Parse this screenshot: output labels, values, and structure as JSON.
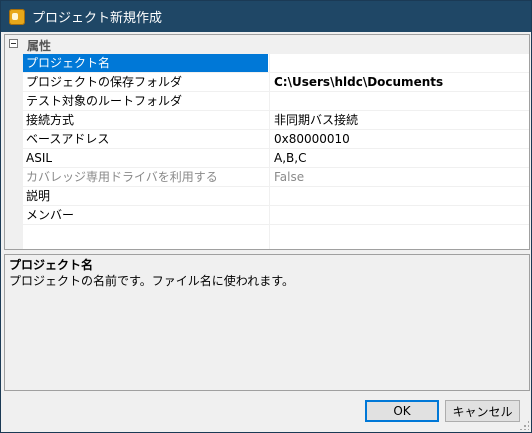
{
  "window": {
    "title": "プロジェクト新規作成"
  },
  "grid": {
    "category": "属性",
    "rows": [
      {
        "name": "プロジェクト名",
        "value": "",
        "selected": true
      },
      {
        "name": "プロジェクトの保存フォルダ",
        "value": "C:\\Users\\hldc\\Documents",
        "bold": true
      },
      {
        "name": "テスト対象のルートフォルダ",
        "value": ""
      },
      {
        "name": "接続方式",
        "value": "非同期バス接続"
      },
      {
        "name": "ベースアドレス",
        "value": "0x80000010"
      },
      {
        "name": "ASIL",
        "value": "A,B,C"
      },
      {
        "name": "カバレッジ専用ドライバを利用する",
        "value": "False",
        "disabled": true
      },
      {
        "name": "説明",
        "value": ""
      },
      {
        "name": "メンバー",
        "value": ""
      }
    ]
  },
  "description": {
    "title": "プロジェクト名",
    "text": "プロジェクトの名前です。ファイル名に使われます。"
  },
  "buttons": {
    "ok": "OK",
    "cancel": "キャンセル"
  }
}
